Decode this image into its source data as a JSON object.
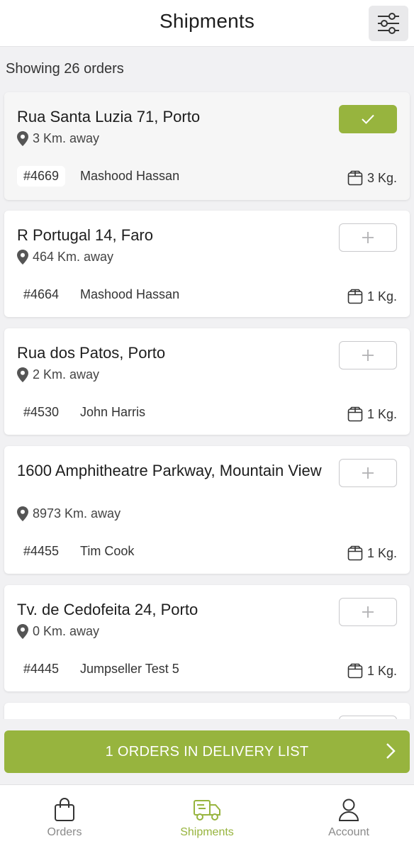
{
  "header": {
    "title": "Shipments",
    "filter_icon": "sliders-icon"
  },
  "summary": {
    "count_text": "Showing 26 orders"
  },
  "colors": {
    "accent": "#97b43e",
    "background": "#f1f1f3"
  },
  "orders": [
    {
      "address": "Rua Santa Luzia 71, Porto",
      "distance": "3 Km. away",
      "number": "#4669",
      "customer": "Mashood Hassan",
      "weight": "3 Kg.",
      "selected": true
    },
    {
      "address": "R Portugal 14, Faro",
      "distance": "464 Km. away",
      "number": "#4664",
      "customer": "Mashood Hassan",
      "weight": "1 Kg.",
      "selected": false
    },
    {
      "address": "Rua dos Patos, Porto",
      "distance": "2 Km. away",
      "number": "#4530",
      "customer": "John Harris",
      "weight": "1 Kg.",
      "selected": false
    },
    {
      "address": "1600 Amphitheatre Parkway,  Mountain View",
      "distance": "8973 Km. away",
      "number": "#4455",
      "customer": "Tim Cook",
      "weight": "1 Kg.",
      "selected": false
    },
    {
      "address": "Tv. de Cedofeita 24, Porto",
      "distance": "0 Km. away",
      "number": "#4445",
      "customer": "Jumpseller Test 5",
      "weight": "1 Kg.",
      "selected": false
    }
  ],
  "delivery_list": {
    "label": "1 ORDERS IN DELIVERY LIST"
  },
  "tabs": [
    {
      "label": "Orders",
      "icon": "shopping-bag-icon",
      "active": false
    },
    {
      "label": "Shipments",
      "icon": "delivery-truck-icon",
      "active": true
    },
    {
      "label": "Account",
      "icon": "user-icon",
      "active": false
    }
  ]
}
